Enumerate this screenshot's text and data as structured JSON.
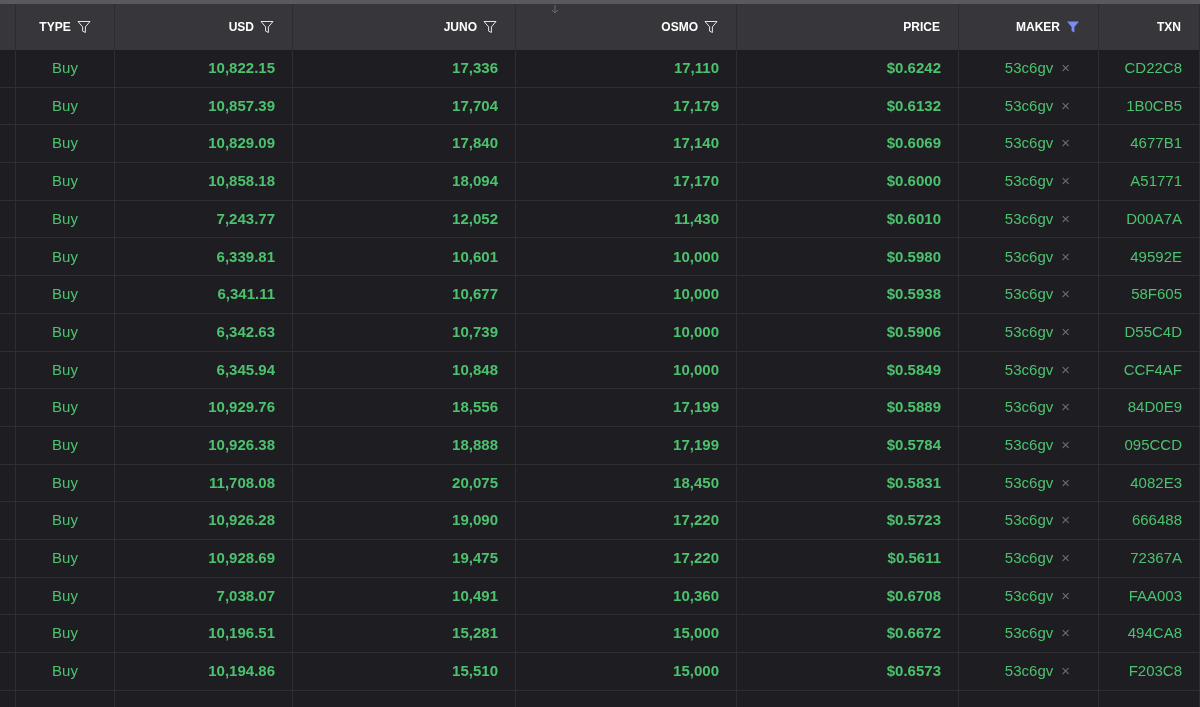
{
  "columns": [
    {
      "label": "TYPE",
      "filterable": true,
      "filtered": false
    },
    {
      "label": "USD",
      "filterable": true,
      "filtered": false
    },
    {
      "label": "JUNO",
      "filterable": true,
      "filtered": false
    },
    {
      "label": "OSMO",
      "filterable": true,
      "filtered": false
    },
    {
      "label": "PRICE",
      "filterable": false
    },
    {
      "label": "MAKER",
      "filterable": true,
      "filtered": true
    },
    {
      "label": "TXN",
      "filterable": false
    }
  ],
  "rows": [
    {
      "type": "Buy",
      "usd": "10,822.15",
      "juno": "17,336",
      "osmo": "17,110",
      "price": "$0.6242",
      "maker": "53c6gv",
      "remove": "×",
      "txn": "CD22C8"
    },
    {
      "type": "Buy",
      "usd": "10,857.39",
      "juno": "17,704",
      "osmo": "17,179",
      "price": "$0.6132",
      "maker": "53c6gv",
      "remove": "×",
      "txn": "1B0CB5"
    },
    {
      "type": "Buy",
      "usd": "10,829.09",
      "juno": "17,840",
      "osmo": "17,140",
      "price": "$0.6069",
      "maker": "53c6gv",
      "remove": "×",
      "txn": "4677B1"
    },
    {
      "type": "Buy",
      "usd": "10,858.18",
      "juno": "18,094",
      "osmo": "17,170",
      "price": "$0.6000",
      "maker": "53c6gv",
      "remove": "×",
      "txn": "A51771"
    },
    {
      "type": "Buy",
      "usd": "7,243.77",
      "juno": "12,052",
      "osmo": "11,430",
      "price": "$0.6010",
      "maker": "53c6gv",
      "remove": "×",
      "txn": "D00A7A"
    },
    {
      "type": "Buy",
      "usd": "6,339.81",
      "juno": "10,601",
      "osmo": "10,000",
      "price": "$0.5980",
      "maker": "53c6gv",
      "remove": "×",
      "txn": "49592E"
    },
    {
      "type": "Buy",
      "usd": "6,341.11",
      "juno": "10,677",
      "osmo": "10,000",
      "price": "$0.5938",
      "maker": "53c6gv",
      "remove": "×",
      "txn": "58F605"
    },
    {
      "type": "Buy",
      "usd": "6,342.63",
      "juno": "10,739",
      "osmo": "10,000",
      "price": "$0.5906",
      "maker": "53c6gv",
      "remove": "×",
      "txn": "D55C4D"
    },
    {
      "type": "Buy",
      "usd": "6,345.94",
      "juno": "10,848",
      "osmo": "10,000",
      "price": "$0.5849",
      "maker": "53c6gv",
      "remove": "×",
      "txn": "CCF4AF"
    },
    {
      "type": "Buy",
      "usd": "10,929.76",
      "juno": "18,556",
      "osmo": "17,199",
      "price": "$0.5889",
      "maker": "53c6gv",
      "remove": "×",
      "txn": "84D0E9"
    },
    {
      "type": "Buy",
      "usd": "10,926.38",
      "juno": "18,888",
      "osmo": "17,199",
      "price": "$0.5784",
      "maker": "53c6gv",
      "remove": "×",
      "txn": "095CCD"
    },
    {
      "type": "Buy",
      "usd": "11,708.08",
      "juno": "20,075",
      "osmo": "18,450",
      "price": "$0.5831",
      "maker": "53c6gv",
      "remove": "×",
      "txn": "4082E3"
    },
    {
      "type": "Buy",
      "usd": "10,926.28",
      "juno": "19,090",
      "osmo": "17,220",
      "price": "$0.5723",
      "maker": "53c6gv",
      "remove": "×",
      "txn": "666488"
    },
    {
      "type": "Buy",
      "usd": "10,928.69",
      "juno": "19,475",
      "osmo": "17,220",
      "price": "$0.5611",
      "maker": "53c6gv",
      "remove": "×",
      "txn": "72367A"
    },
    {
      "type": "Buy",
      "usd": "7,038.07",
      "juno": "10,491",
      "osmo": "10,360",
      "price": "$0.6708",
      "maker": "53c6gv",
      "remove": "×",
      "txn": "FAA003"
    },
    {
      "type": "Buy",
      "usd": "10,196.51",
      "juno": "15,281",
      "osmo": "15,000",
      "price": "$0.6672",
      "maker": "53c6gv",
      "remove": "×",
      "txn": "494CA8"
    },
    {
      "type": "Buy",
      "usd": "10,194.86",
      "juno": "15,510",
      "osmo": "15,000",
      "price": "$0.6573",
      "maker": "53c6gv",
      "remove": "×",
      "txn": "F203C8"
    }
  ]
}
